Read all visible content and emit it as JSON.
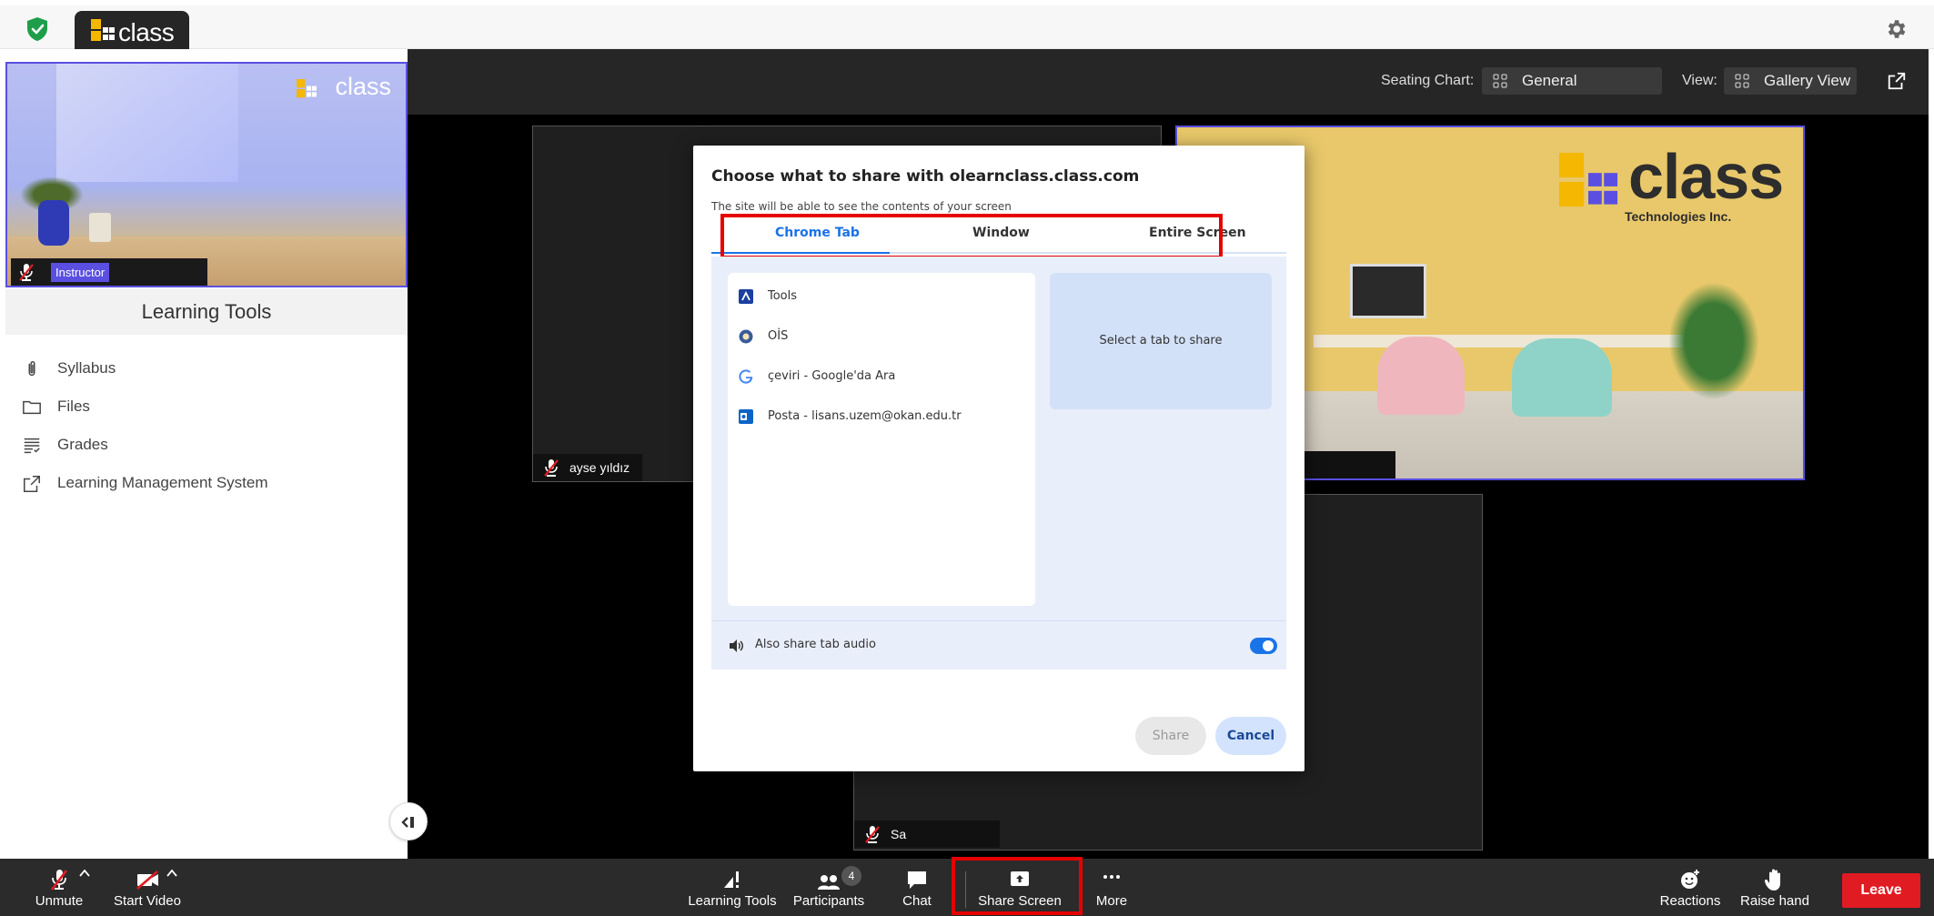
{
  "app": {
    "brand": "class",
    "colors": {
      "brand_purple": "#5a4fe0",
      "leave_red": "#e11b22",
      "chrome_blue": "#1a73e8",
      "highlight_red": "#e60000"
    }
  },
  "left_panel": {
    "instructor_badge": "Instructor",
    "video_logo": "class",
    "learning_tools_title": "Learning Tools",
    "items": [
      {
        "label": "Syllabus",
        "icon": "paperclip-icon"
      },
      {
        "label": "Files",
        "icon": "folder-icon"
      },
      {
        "label": "Grades",
        "icon": "grades-icon"
      },
      {
        "label": "Learning Management System",
        "icon": "external-link-icon"
      }
    ]
  },
  "stage": {
    "seating_chart_label": "Seating Chart:",
    "seating_chart_value": "General",
    "view_label": "View:",
    "view_value": "Gallery View",
    "tiles": [
      {
        "name": "ayse yıldız"
      },
      {
        "logo_text": "class",
        "logo_sub": "Technologies Inc."
      },
      {
        "name": "Sa"
      }
    ]
  },
  "share_dialog": {
    "title": "Choose what to share with olearnclass.class.com",
    "subtitle": "The site will be able to see the contents of your screen",
    "tabs": [
      "Chrome Tab",
      "Window",
      "Entire Screen"
    ],
    "active_tab": "Chrome Tab",
    "tab_items": [
      {
        "label": "Tools",
        "icon": "tools-favicon"
      },
      {
        "label": "OİS",
        "icon": "ois-favicon"
      },
      {
        "label": "çeviri - Google'da Ara",
        "icon": "google-favicon"
      },
      {
        "label": "Posta - lisans.uzem@okan.edu.tr",
        "icon": "outlook-favicon"
      }
    ],
    "preview_text": "Select a tab to share",
    "audio_label": "Also share tab audio",
    "audio_enabled": true,
    "share_button": "Share",
    "cancel_button": "Cancel"
  },
  "bottombar": {
    "unmute": "Unmute",
    "start_video": "Start Video",
    "learning_tools": "Learning Tools",
    "participants": "Participants",
    "participants_count": "4",
    "chat": "Chat",
    "share_screen": "Share Screen",
    "more": "More",
    "reactions": "Reactions",
    "raise_hand": "Raise hand",
    "leave": "Leave"
  }
}
